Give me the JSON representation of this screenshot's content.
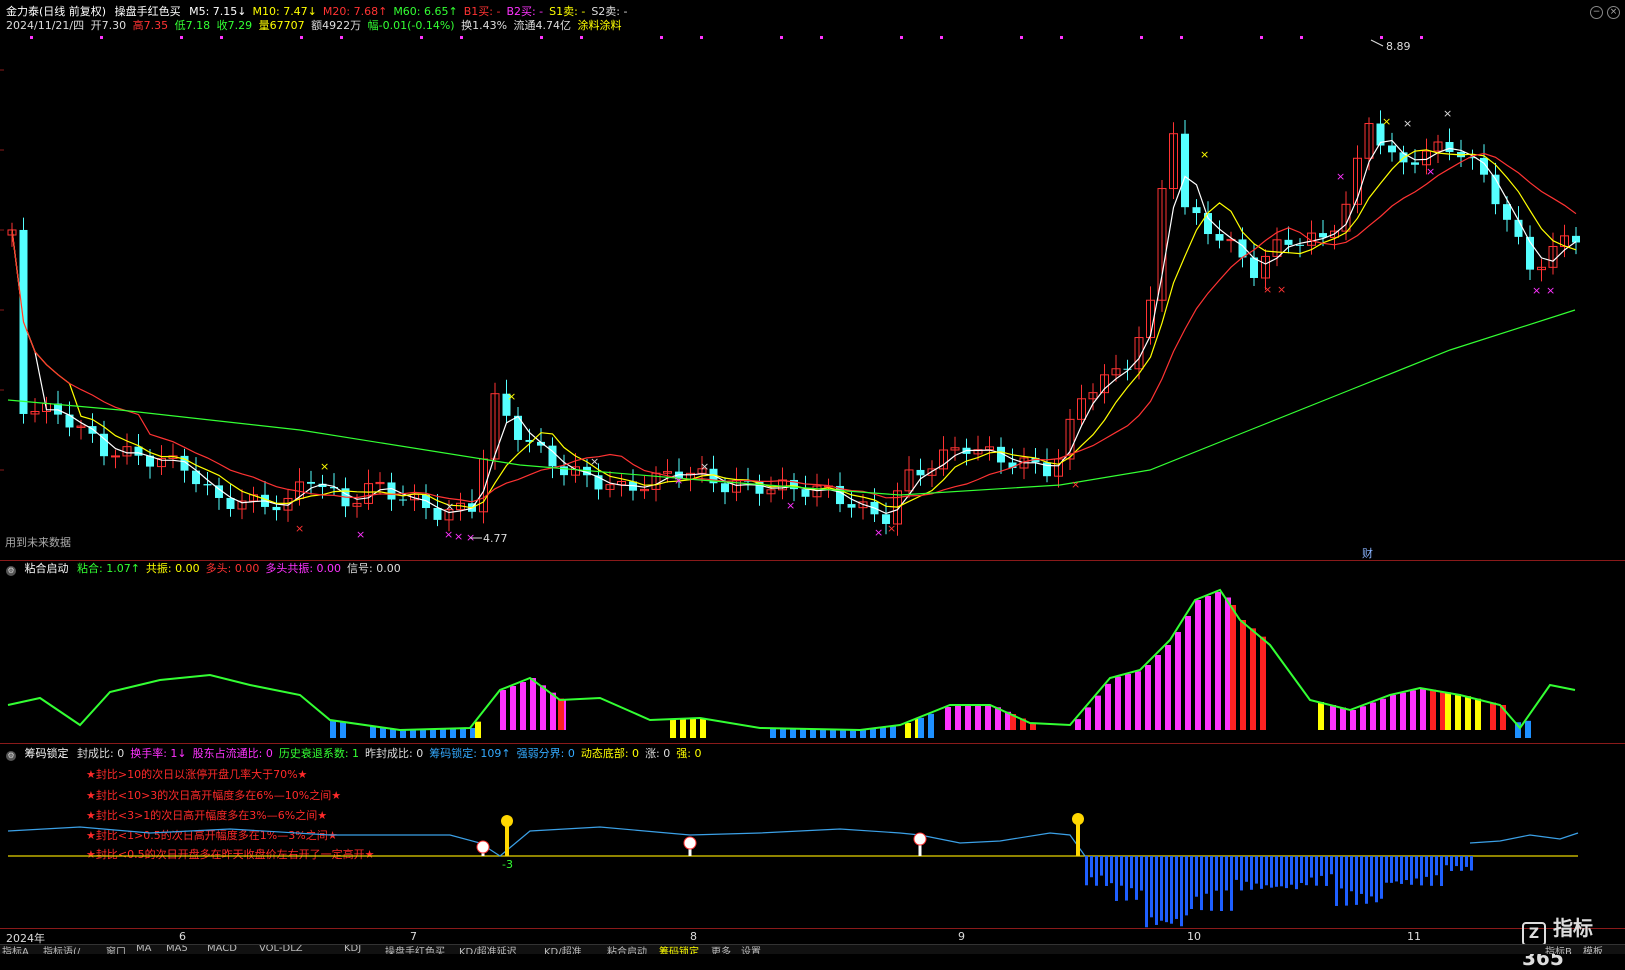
{
  "main": {
    "stock_name": "金力泰(日线 前复权)",
    "indicator_name": "操盘手红色买",
    "ma": [
      {
        "label": "M5: 7.15",
        "arrow": "↓",
        "color": "#ffffff"
      },
      {
        "label": "M10: 7.47",
        "arrow": "↓",
        "color": "#ffff00"
      },
      {
        "label": "M20: 7.68",
        "arrow": "↑",
        "color": "#ff3333"
      },
      {
        "label": "M60: 6.65",
        "arrow": "↑",
        "color": "#33ff33"
      },
      {
        "label": "B1买: -",
        "arrow": "",
        "color": "#ff3333"
      },
      {
        "label": "B2买: -",
        "arrow": "",
        "color": "#ff33ff"
      },
      {
        "label": "S1卖: -",
        "arrow": "",
        "color": "#ffff00"
      },
      {
        "label": "S2卖: -",
        "arrow": "",
        "color": "#dddddd"
      }
    ],
    "quote": {
      "date": "2024/11/21/四",
      "open": "开7.30",
      "high": "高7.35",
      "low": "低7.18",
      "close": "收7.29",
      "volume": "量67707",
      "amount": "额4922万",
      "change": "幅-0.01(-0.14%)",
      "turnover": "换1.43%",
      "float_cap": "流通4.74亿",
      "concept": "涂料涂料"
    },
    "future_data_label": "用到未来数据",
    "max_price_label": "8.89",
    "min_price_label": "4.77",
    "fin_badge": "财"
  },
  "panel2": {
    "title": "粘合启动",
    "items": [
      {
        "label": "粘合: 1.07",
        "arrow": "↑",
        "color": "#33ff33"
      },
      {
        "label": "共振: 0.00",
        "arrow": "",
        "color": "#ffff00"
      },
      {
        "label": "多头: 0.00",
        "arrow": "",
        "color": "#ff3333"
      },
      {
        "label": "多头共振: 0.00",
        "arrow": "",
        "color": "#ff33ff"
      },
      {
        "label": "信号: 0.00",
        "arrow": "",
        "color": "#dddddd"
      }
    ]
  },
  "panel3": {
    "title": "筹码锁定",
    "items": [
      {
        "label": "封成比: 0",
        "color": "#dddddd"
      },
      {
        "label": "换手率: 1",
        "color": "#ff33ff",
        "arrow": "↓"
      },
      {
        "label": "股东占流通比: 0",
        "color": "#ff33ff"
      },
      {
        "label": "历史衰退系数: 1",
        "color": "#33ff33"
      },
      {
        "label": "昨封成比: 0",
        "color": "#dddddd"
      },
      {
        "label": "筹码锁定: 109",
        "color": "#33aaff",
        "arrow": "↑"
      },
      {
        "label": "强弱分界: 0",
        "color": "#33aaff"
      },
      {
        "label": "动态底部: 0",
        "color": "#ffff00"
      },
      {
        "label": "涨: 0",
        "color": "#dddddd"
      },
      {
        "label": "强: 0",
        "color": "#ffff00"
      }
    ],
    "notes": [
      "★封比>10的次日以涨停开盘几率大于70%★",
      "★封比<10>3的次日高开幅度多在6%—10%之间★",
      "★封比<3>1的次日高开幅度多在3%—6%之间★",
      "★封比<1>0.5的次日高开幅度多在1%—3%之间★",
      "★封比<0.5的次日开盘多在昨天收盘价左右开了一定高开★"
    ],
    "value_label": "-3"
  },
  "axis": {
    "months": [
      {
        "label": "2024年"
      },
      {
        "label": "6"
      },
      {
        "label": "7"
      },
      {
        "label": "8"
      },
      {
        "label": "9"
      },
      {
        "label": "10"
      },
      {
        "label": "11"
      }
    ]
  },
  "bottom_tabs": [
    "指标A",
    "指标语(/",
    "窗口",
    "MA",
    "MA5",
    "MACD",
    "VOL-DLZ",
    "KDJ",
    "操盘手红色买",
    "KD/超准延迟",
    "KD/超准",
    "粘合启动",
    "筹码锁定",
    "更多",
    "设置"
  ],
  "right_tabs": [
    "指标B",
    "模板"
  ],
  "watermark": "指标365",
  "colors": {
    "up": "#ff3333",
    "down": "#55ffff",
    "m5": "#ffffff",
    "m10": "#ffff00",
    "m20": "#ff3333",
    "m60": "#33ff33",
    "magenta": "#ff33ff",
    "blue": "#1e90ff"
  }
}
